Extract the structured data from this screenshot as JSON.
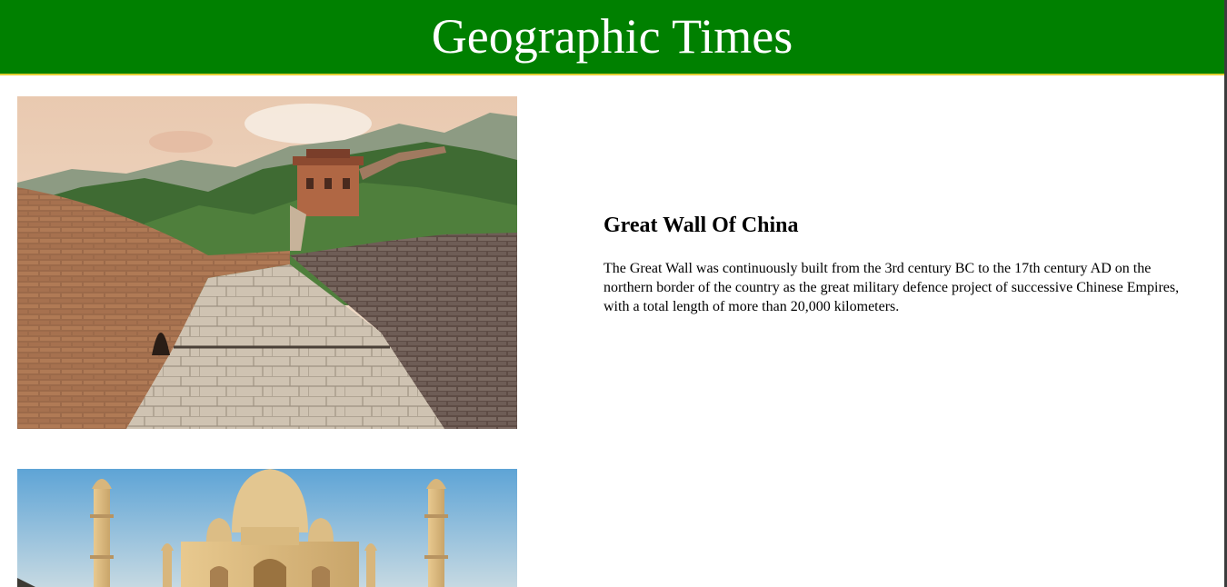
{
  "header": {
    "title": "Geographic Times"
  },
  "articles": [
    {
      "heading": "Great Wall Of China",
      "body": "The Great Wall was continuously built from the 3rd century BC to the 17th century AD on the northern border of the country as the great military defence project of successive Chinese Empires, with a total length of more than 20,000 kilometers."
    }
  ],
  "colors": {
    "header_bg": "#008000",
    "header_border": "#e3cf34",
    "header_text": "#ffffff"
  }
}
